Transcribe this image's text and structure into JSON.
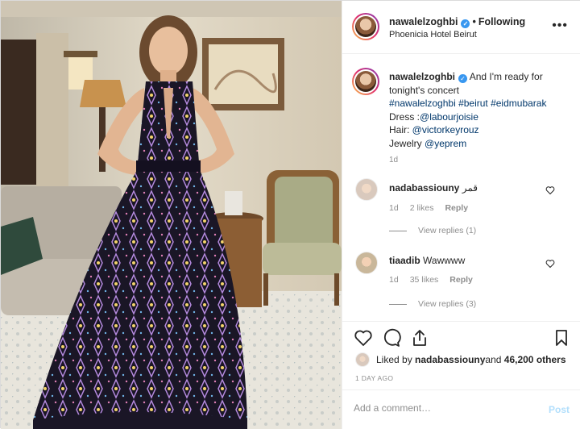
{
  "post": {
    "username": "nawalelzoghbi",
    "follow_status": "Following",
    "location": "Phoenicia Hotel Beirut",
    "caption": {
      "username": "nawalelzoghbi",
      "text": "And I'm ready for tonight's concert",
      "hashtags": "#nawalelzoghbi #beirut #eidmubarak",
      "dress_label": "Dress :",
      "dress_tag": "@labourjoisie",
      "hair_label": "Hair: ",
      "hair_tag": "@victorkeyrouz",
      "jewelry_label": "Jewelry ",
      "jewelry_tag": "@yeprem",
      "time": "1d"
    }
  },
  "comments": [
    {
      "username": "nadabassiouny",
      "text": "قمر",
      "time": "1d",
      "likes": "2 likes",
      "reply": "Reply",
      "view_replies": "View replies (1)"
    },
    {
      "username": "tiaadib",
      "text": "Wawwww",
      "time": "1d",
      "likes": "35 likes",
      "reply": "Reply",
      "view_replies": "View replies (3)"
    }
  ],
  "likes": {
    "prefix": "Liked by ",
    "user": "nadabassiouny",
    "middle": " and ",
    "count": "46,200 others"
  },
  "date": "1 DAY AGO",
  "add_comment": {
    "placeholder": "Add a comment…",
    "post_label": "Post"
  },
  "icons": [
    "verified-icon",
    "more-icon",
    "heart-icon",
    "comment-icon",
    "share-icon",
    "bookmark-icon"
  ],
  "colors": {
    "verified": "#3897f0",
    "link": "#00376b",
    "post_disabled": "#b2dffc",
    "muted": "#8e8e8e"
  }
}
